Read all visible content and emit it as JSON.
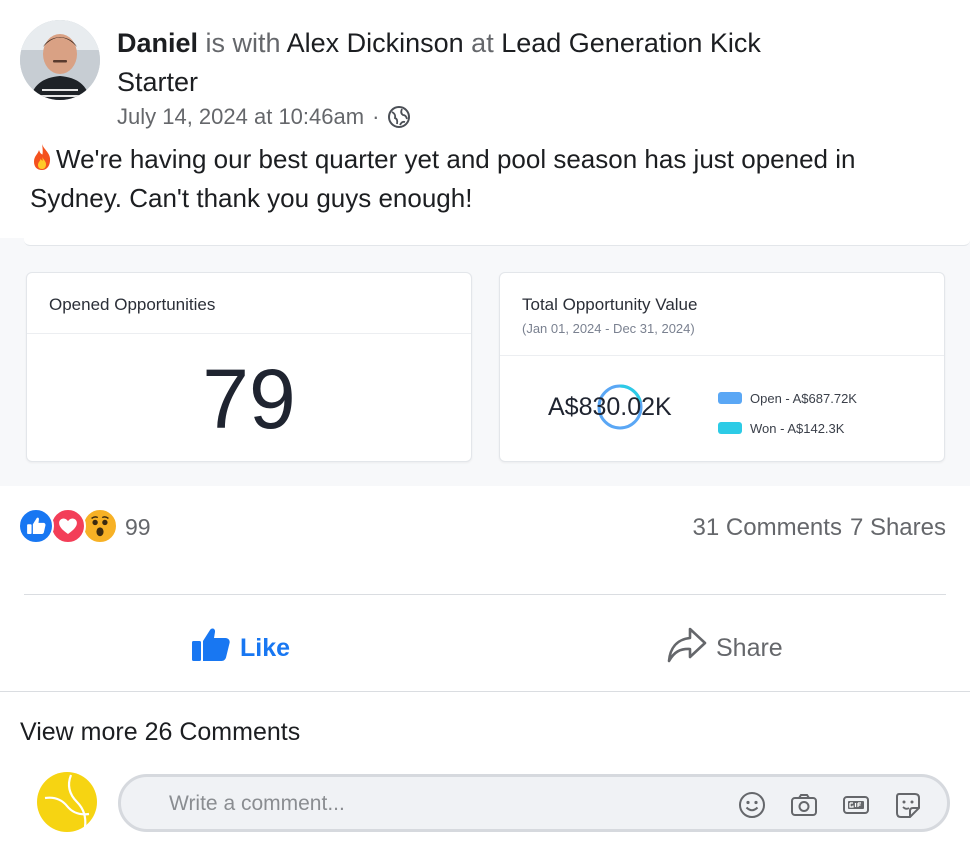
{
  "post": {
    "author": "Daniel",
    "with_text": "is with",
    "tagged": "Alex Dickinson",
    "at_text": "at",
    "location": "Lead Generation Kick Starter",
    "timestamp": "July 14, 2024 at 10:46am",
    "separator": "·",
    "audience_icon": "globe-icon",
    "body": "We're having our best quarter yet and pool season has just opened in Sydney. Can't thank you guys enough!",
    "body_emoji": "flame-icon"
  },
  "embed": {
    "opened": {
      "title": "Opened Opportunities",
      "value": "79"
    },
    "total": {
      "title": "Total Opportunity Value",
      "range": "(Jan 01, 2024 - Dec 31, 2024)",
      "value": "A$830.02K",
      "legend": [
        {
          "label": "Open - A$687.72K",
          "color": "#5aa7f5"
        },
        {
          "label": "Won - A$142.3K",
          "color": "#2ccbe6"
        }
      ]
    }
  },
  "stats": {
    "reactions": [
      "like-icon",
      "love-icon",
      "wow-icon"
    ],
    "reaction_count": "99",
    "comments": "31 Comments",
    "shares": "7 Shares"
  },
  "actions": {
    "like": "Like",
    "share": "Share"
  },
  "comments": {
    "view_more": "View more 26 Comments",
    "placeholder": "Write a comment...",
    "tools": [
      "emoji-icon",
      "camera-icon",
      "gif-icon",
      "sticker-icon"
    ]
  },
  "colors": {
    "brand_blue": "#1877f2",
    "muted_text": "#65676b",
    "love_red": "#f33e58",
    "wow_yellow": "#f7b125"
  }
}
